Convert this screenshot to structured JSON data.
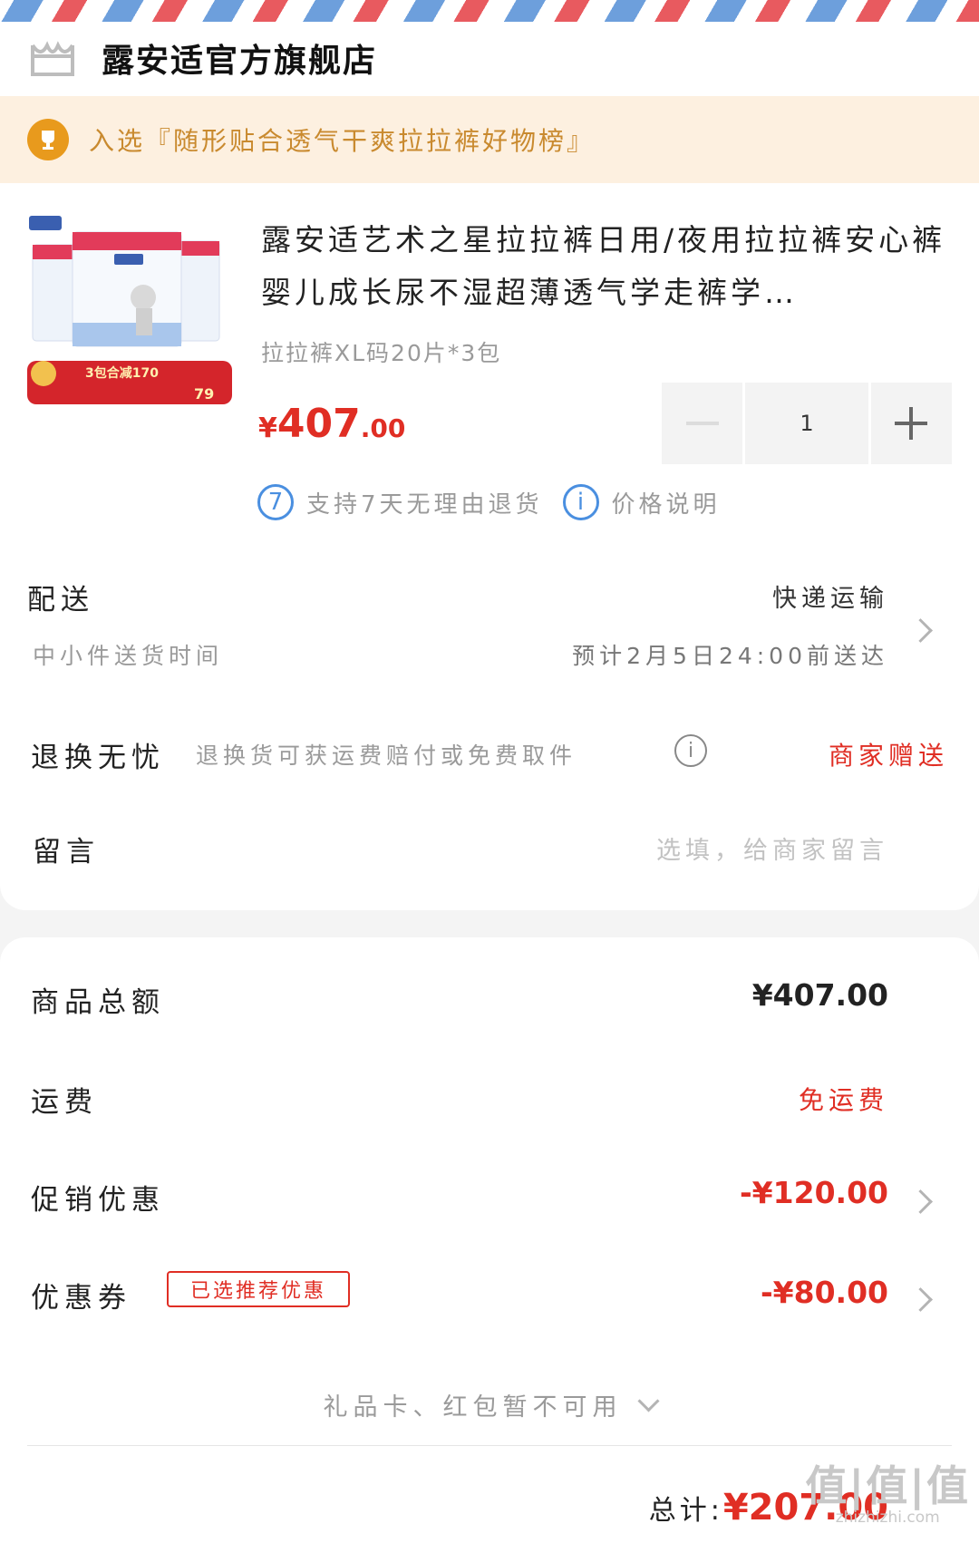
{
  "shop": {
    "name": "露安适官方旗舰店"
  },
  "rank_banner": {
    "text": "入选『随形贴合透气干爽拉拉裤好物榜』"
  },
  "product": {
    "title": "露安适艺术之星拉拉裤日用/夜用拉拉裤安心裤婴儿成长尿不湿超薄透气学走裤学…",
    "sku": "拉拉裤XL码20片*3包",
    "price_symbol": "¥",
    "price_int": "407",
    "price_dec": ".00",
    "quantity": "1",
    "thumb_banner": "3包合减170",
    "thumb_price": "79",
    "badges": [
      {
        "icon": "7",
        "label": "支持7天无理由退货"
      },
      {
        "icon": "i",
        "label": "价格说明"
      }
    ]
  },
  "delivery": {
    "label": "配送",
    "method": "快递运输",
    "sub_label": "中小件送货时间",
    "estimate": "预计2月5日24:00前送达"
  },
  "returns": {
    "label": "退换无忧",
    "desc": "退换货可获运费赔付或免费取件",
    "value": "商家赠送"
  },
  "message": {
    "label": "留言",
    "placeholder": "选填，给商家留言"
  },
  "summary": {
    "goods_total_label": "商品总额",
    "goods_total": "¥407.00",
    "shipping_label": "运费",
    "shipping": "免运费",
    "promo_label": "促销优惠",
    "promo": "-¥120.00",
    "coupon_label": "优惠券",
    "coupon_tag": "已选推荐优惠",
    "coupon": "-¥80.00",
    "gift_note": "礼品卡、红包暂不可用",
    "total_label": "总计:",
    "total": "¥207.00"
  },
  "watermark": {
    "big": "值|值|值",
    "small": "zhizhizhi.com"
  },
  "colors": {
    "accent_red": "#e02e24",
    "link_blue": "#4a8fe0",
    "banner_bg": "#fdf0e0",
    "banner_text": "#c98a2f"
  }
}
